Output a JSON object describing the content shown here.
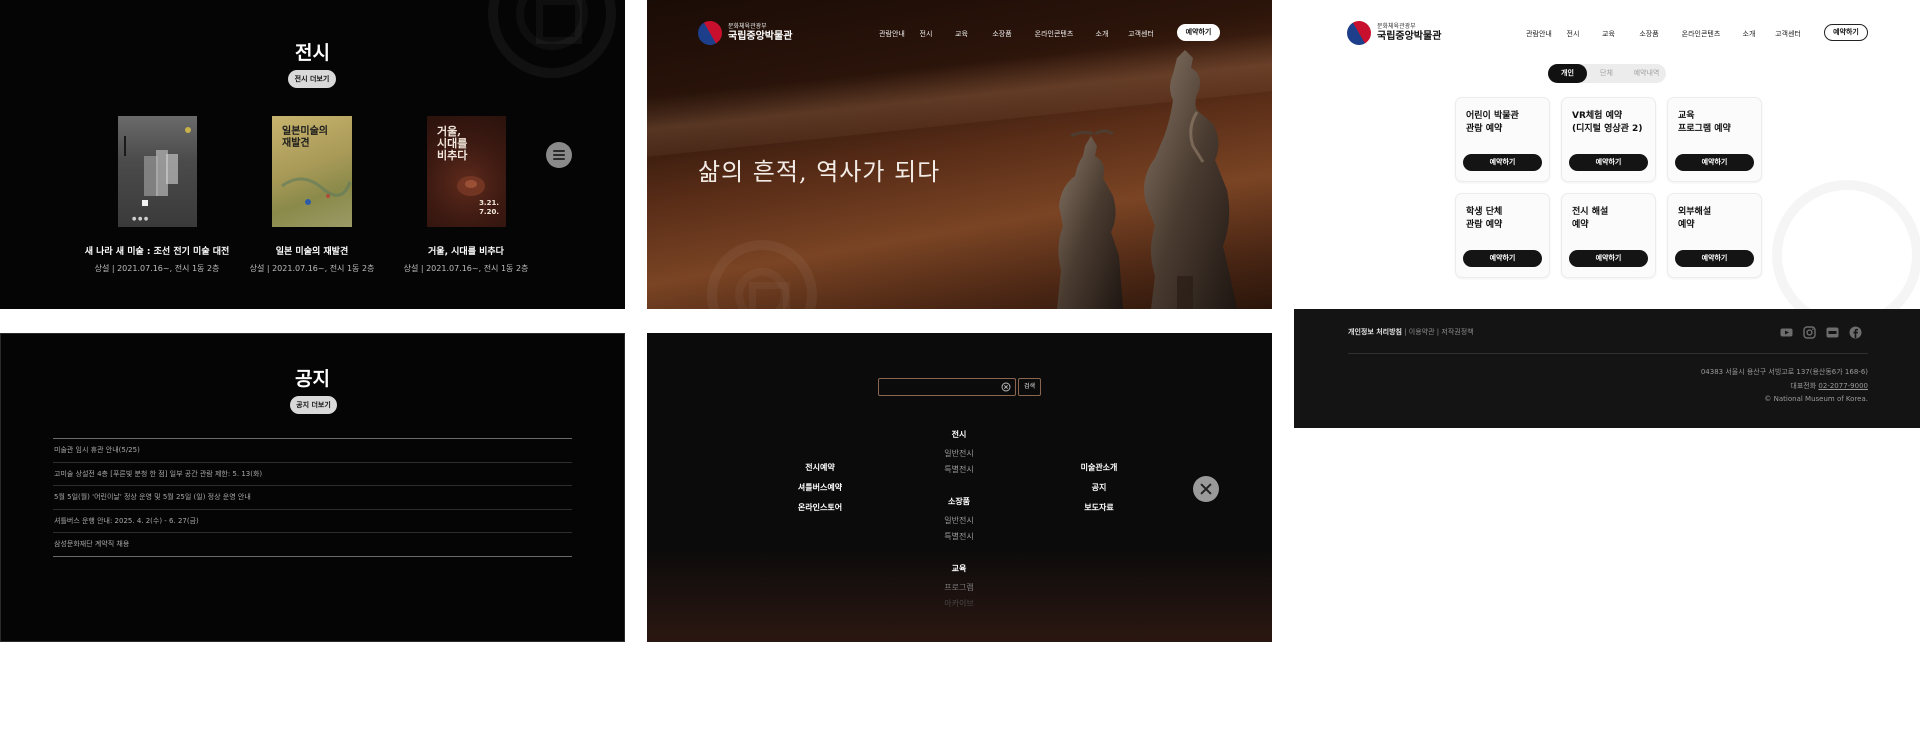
{
  "exhibition": {
    "title": "전시",
    "more_button": "전시 더보기",
    "items": [
      {
        "title": "새 나라 새 미술 : 조선 전기 미술 대전",
        "meta": "상설 | 2021.07.16~, 전시 1동 2층"
      },
      {
        "title": "일본 미술의 재발견",
        "meta": "상설 | 2021.07.16~, 전시 1동 2층",
        "poster_text": "일본미술의\n재발견"
      },
      {
        "title": "거울, 시대를 비추다",
        "meta": "상설 | 2021.07.16~, 전시 1동 2층",
        "poster_text": "거울,\n시대를\n비추다",
        "poster_date": "3.21.\n7.20."
      }
    ]
  },
  "header": {
    "logo_small": "문화체육관광부",
    "logo_big": "국립중앙박물관",
    "nav": [
      "관람안내",
      "전시",
      "교육",
      "소장품",
      "온라인콘텐츠",
      "소개",
      "고객센터"
    ],
    "reserve_button": "예약하기"
  },
  "hero": {
    "headline": "삶의 흔적, 역사가 되다"
  },
  "reservation": {
    "tabs": [
      {
        "label": "개인",
        "active": true
      },
      {
        "label": "단체",
        "active": false
      },
      {
        "label": "예약내역",
        "active": false
      }
    ],
    "cards": [
      {
        "title": "어린이 박물관\n관람 예약",
        "button": "예약하기"
      },
      {
        "title": "VR체험 예약\n(디지털 영상관 2)",
        "button": "예약하기"
      },
      {
        "title": "교육\n프로그램 예약",
        "button": "예약하기"
      },
      {
        "title": "학생 단체\n관람 예약",
        "button": "예약하기"
      },
      {
        "title": "전시 해설\n예약",
        "button": "예약하기"
      },
      {
        "title": "외부해설\n예약",
        "button": "예약하기"
      }
    ]
  },
  "footer": {
    "privacy": "개인정보 처리방침",
    "terms": "이용약관",
    "copyright_policy": "저작권정책",
    "address": "04383 서울시 용산구 서빙고로 137(용산동6가 168-6)",
    "phone_label": "대표전화",
    "phone": "02-2077-9000",
    "copyright": "© National Museum of Korea.",
    "social_icons": [
      "youtube-icon",
      "instagram-icon",
      "blog-icon",
      "facebook-icon"
    ]
  },
  "notice": {
    "title": "공지",
    "more_button": "공지 더보기",
    "items": [
      "미술관 임시 휴관 안내(5/25)",
      "고미술 상설전 4층 [푸른빛 분청 한 점] 일부 공간 관람 제한: 5. 13(화)",
      "5월 5일(월) '어린이날' 정상 운영 및 5월 25일 (일) 정상 운영 안내",
      "셔틀버스 운행 안내: 2025. 4. 2(수) - 6. 27(금)",
      "삼성문화재단 계약직 채용"
    ]
  },
  "menu": {
    "search_button": "검색",
    "exhibit_heading": "전시",
    "exhibit_items": [
      "일반전시",
      "특별전시"
    ],
    "collection_heading": "소장품",
    "collection_items": [
      "일반전시",
      "특별전시"
    ],
    "education_heading": "교육",
    "education_items": [
      "프로그램",
      "아카이브"
    ],
    "left_links": [
      "전시예약",
      "셔틀버스예약",
      "온라인스토어"
    ],
    "right_links": [
      "미술관소개",
      "공지",
      "보도자료"
    ]
  },
  "colors": {
    "dark_bg": "#050505",
    "hero_bronze": "#7a4424",
    "button_dark": "#141414",
    "logo_red": "#c8102e",
    "logo_blue": "#1d3f8b"
  }
}
